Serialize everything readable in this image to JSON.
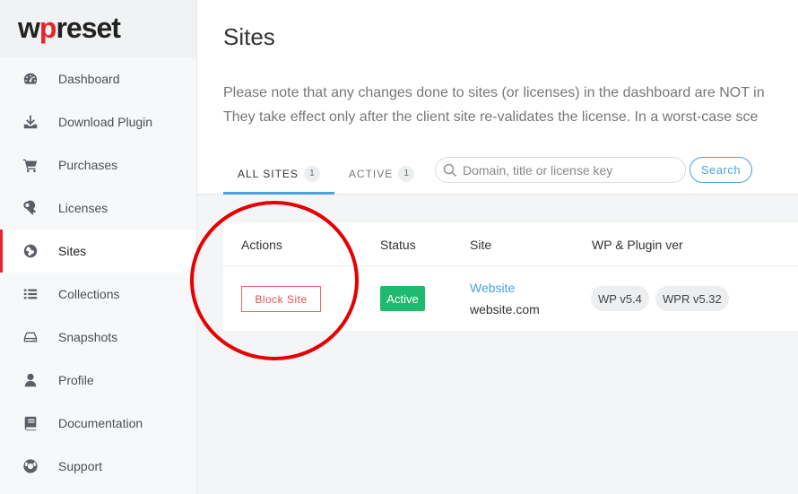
{
  "logo": {
    "text_a": "w",
    "text_o": "p",
    "text_b": "reset"
  },
  "sidebar": {
    "items": [
      {
        "label": "Dashboard",
        "icon": "dashboard-icon",
        "active": false
      },
      {
        "label": "Download Plugin",
        "icon": "download-icon",
        "active": false
      },
      {
        "label": "Purchases",
        "icon": "cart-icon",
        "active": false
      },
      {
        "label": "Licenses",
        "icon": "key-icon",
        "active": false
      },
      {
        "label": "Sites",
        "icon": "globe-icon",
        "active": true
      },
      {
        "label": "Collections",
        "icon": "list-icon",
        "active": false
      },
      {
        "label": "Snapshots",
        "icon": "drive-icon",
        "active": false
      },
      {
        "label": "Profile",
        "icon": "user-icon",
        "active": false
      },
      {
        "label": "Documentation",
        "icon": "book-icon",
        "active": false
      },
      {
        "label": "Support",
        "icon": "lifebuoy-icon",
        "active": false
      }
    ]
  },
  "main": {
    "title": "Sites",
    "note_line1": "Please note that any changes done to sites (or licenses) in the dashboard are NOT in",
    "note_line2": "They take effect only after the client site re-validates the license. In a worst-case sce",
    "tabs": [
      {
        "label": "ALL SITES",
        "count": "1"
      },
      {
        "label": "ACTIVE",
        "count": "1"
      }
    ],
    "search": {
      "placeholder": "Domain, title or license key",
      "button": "Search"
    }
  },
  "table": {
    "headers": [
      "Actions",
      "Status",
      "Site",
      "WP & Plugin ver"
    ],
    "rows": [
      {
        "action": "Block Site",
        "status": "Active",
        "site_title": "Website",
        "site_domain": "website.com",
        "wp_ver": "WP v5.4",
        "wpr_ver": "WPR v5.32"
      }
    ]
  },
  "colors": {
    "accent": "#4aa3df",
    "brand": "#e8232a",
    "active": "#1fba6e",
    "annotation": "#e60000"
  }
}
